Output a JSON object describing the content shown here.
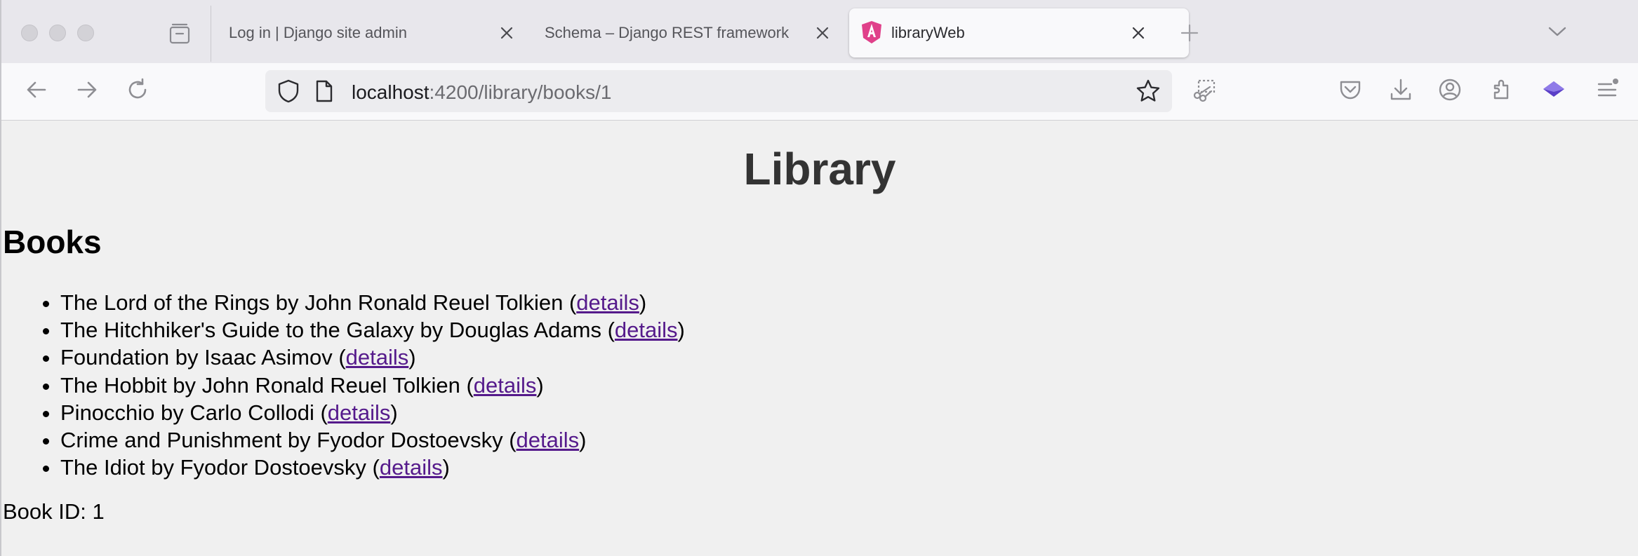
{
  "browser": {
    "tabs": [
      {
        "title": "Log in | Django site admin"
      },
      {
        "title": "Schema – Django REST framework"
      },
      {
        "title": "libraryWeb"
      }
    ],
    "url": {
      "host": "localhost",
      "path": ":4200/library/books/1"
    }
  },
  "page": {
    "title": "Library",
    "section_title": "Books",
    "books": [
      {
        "text": "The Lord of the Rings by John Ronald Reuel Tolkien",
        "link": "details"
      },
      {
        "text": "The Hitchhiker's Guide to the Galaxy by Douglas Adams",
        "link": "details"
      },
      {
        "text": "Foundation by Isaac Asimov",
        "link": "details"
      },
      {
        "text": "The Hobbit by John Ronald Reuel Tolkien",
        "link": "details"
      },
      {
        "text": "Pinocchio by Carlo Collodi",
        "link": "details"
      },
      {
        "text": "Crime and Punishment by Fyodor Dostoevsky",
        "link": "details"
      },
      {
        "text": "The Idiot by Fyodor Dostoevsky",
        "link": "details"
      }
    ],
    "book_id_text": "Book ID: 1"
  },
  "colors": {
    "link": "#551a8b",
    "page_background": "#f0f0f0",
    "title": "#333333"
  },
  "icons": [
    "tab-overview-icon",
    "close-icon",
    "angular-logo-icon",
    "new-tab-icon",
    "tab-list-chevron-icon",
    "back-arrow-icon",
    "forward-arrow-icon",
    "reload-icon",
    "shield-icon",
    "page-icon",
    "bookmark-star-icon",
    "screenshot-icon",
    "pocket-icon",
    "download-icon",
    "account-icon",
    "extensions-icon",
    "extension-layers-icon",
    "menu-icon"
  ]
}
